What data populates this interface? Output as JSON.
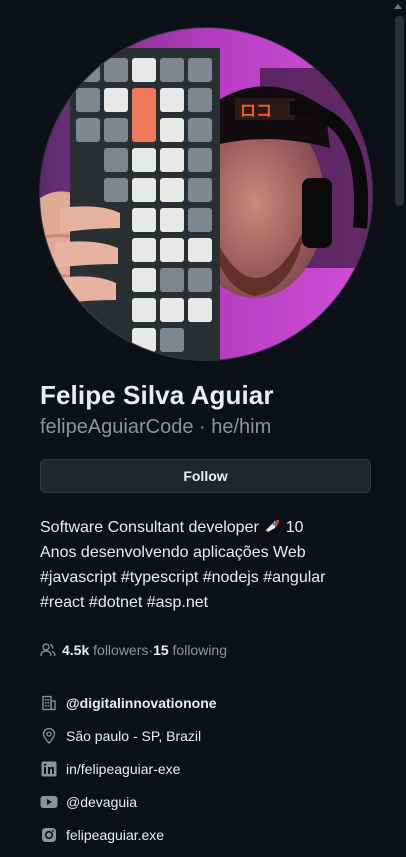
{
  "profile": {
    "name": "Felipe Silva Aguiar",
    "username": "felipeAguiarCode",
    "separator": " · ",
    "pronouns": "he/him",
    "avatar_alt": "avatar-icon"
  },
  "actions": {
    "follow_label": "Follow"
  },
  "bio": {
    "line1": "Software Consultant developer",
    "line1_tail": " 10",
    "line2": "Anos desenvolvendo aplicações Web",
    "line3": "#javascript #typescript #nodejs #angular",
    "line4": "#react #dotnet #asp.net"
  },
  "stats": {
    "followers_count": "4.5k",
    "followers_label": " followers",
    "dot": " · ",
    "following_count": "15",
    "following_label": " following"
  },
  "details": [
    {
      "icon": "organization-icon",
      "text": "@digitalinnovationone",
      "bold": true
    },
    {
      "icon": "location-icon",
      "text": "São paulo - SP, Brazil",
      "bold": false
    },
    {
      "icon": "linkedin-icon",
      "text": "in/felipeaguiar-exe",
      "bold": false
    },
    {
      "icon": "youtube-icon",
      "text": "@devaguia",
      "bold": false
    },
    {
      "icon": "instagram-icon",
      "text": "felipeaguiar.exe",
      "bold": false
    }
  ],
  "colors": {
    "background": "#0d1117",
    "text": "#e6edf3",
    "muted": "#8b949e",
    "button_bg": "#21262d"
  }
}
